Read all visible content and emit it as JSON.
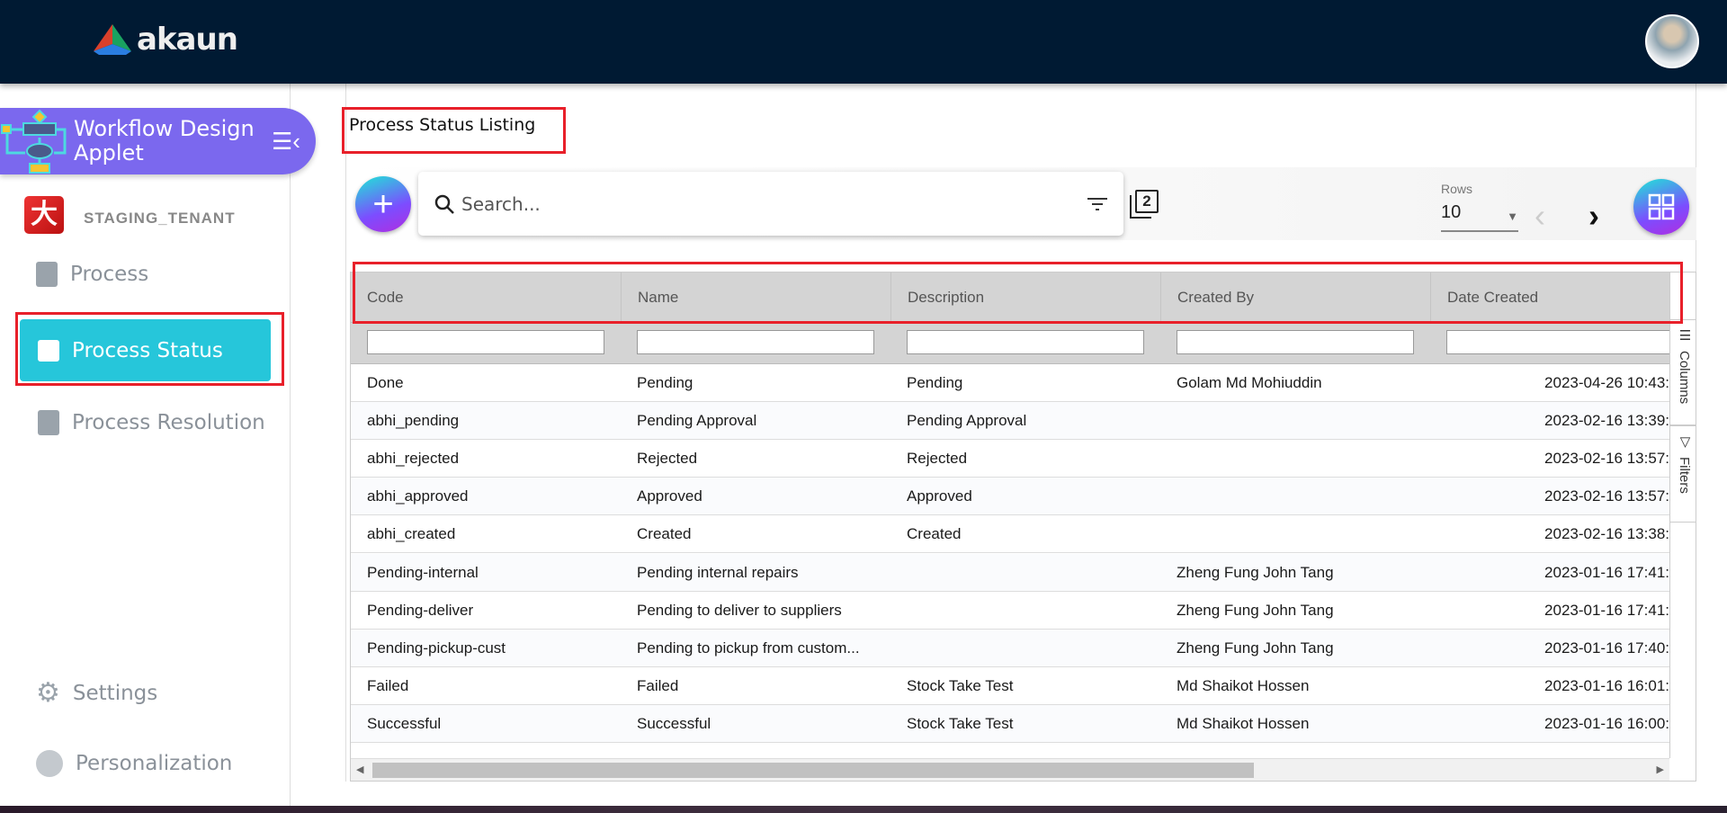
{
  "header": {
    "logo_text": "akaun"
  },
  "sidebar": {
    "applet_title": "Workflow Design Applet",
    "tenant": "STAGING_TENANT",
    "items": [
      {
        "label": "Process"
      },
      {
        "label": "Process Status"
      },
      {
        "label": "Process Resolution"
      }
    ],
    "bottom": [
      {
        "label": "Settings"
      },
      {
        "label": "Personalization"
      }
    ]
  },
  "main": {
    "title": "Process Status Listing",
    "search_placeholder": "Search...",
    "copy_count": "2",
    "rows_label": "Rows",
    "rows_value": "10",
    "columns": [
      "Code",
      "Name",
      "Description",
      "Created By",
      "Date Created"
    ],
    "side_tabs": [
      "Columns",
      "Filters"
    ],
    "rows": [
      [
        "Done",
        "Pending",
        "Pending",
        "Golam Md Mohiuddin",
        "2023-04-26 10:43:"
      ],
      [
        "abhi_pending",
        "Pending Approval",
        "Pending Approval",
        "",
        "2023-02-16 13:39:"
      ],
      [
        "abhi_rejected",
        "Rejected",
        "Rejected",
        "",
        "2023-02-16 13:57:"
      ],
      [
        "abhi_approved",
        "Approved",
        "Approved",
        "",
        "2023-02-16 13:57:"
      ],
      [
        "abhi_created",
        "Created",
        "Created",
        "",
        "2023-02-16 13:38:"
      ],
      [
        "Pending-internal",
        "Pending internal repairs",
        "",
        "Zheng Fung John Tang",
        "2023-01-16 17:41:"
      ],
      [
        "Pending-deliver",
        "Pending to deliver to suppliers",
        "",
        "Zheng Fung John Tang",
        "2023-01-16 17:41:"
      ],
      [
        "Pending-pickup-cust",
        "Pending to pickup from custom...",
        "",
        "Zheng Fung John Tang",
        "2023-01-16 17:40:"
      ],
      [
        "Failed",
        "Failed",
        "Stock Take Test",
        "Md Shaikot Hossen",
        "2023-01-16 16:01:"
      ],
      [
        "Successful",
        "Successful",
        "Stock Take Test",
        "Md Shaikot Hossen",
        "2023-01-16 16:00:"
      ]
    ]
  }
}
